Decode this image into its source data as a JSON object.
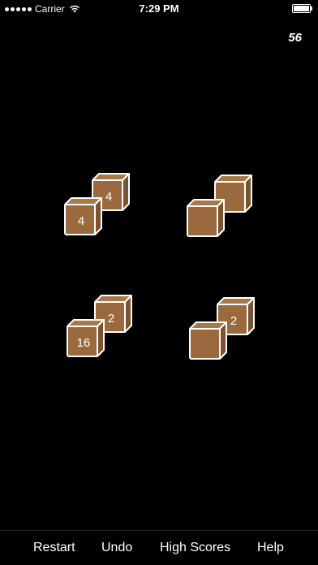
{
  "status_bar": {
    "carrier": "Carrier",
    "time": "7:29 PM"
  },
  "score": "56",
  "colors": {
    "background": "#000000",
    "cube_front": "#9A6A3E",
    "cube_top": "#A87848",
    "cube_side": "#7C5230",
    "cube_edge": "#FFFFFF"
  },
  "groups": [
    {
      "back_value": "4",
      "front_value": "4"
    },
    {
      "back_value": "",
      "front_value": ""
    },
    {
      "back_value": "2",
      "front_value": "16"
    },
    {
      "back_value": "2",
      "front_value": ""
    }
  ],
  "toolbar": {
    "restart_label": "Restart",
    "undo_label": "Undo",
    "high_scores_label": "High Scores",
    "help_label": "Help"
  }
}
